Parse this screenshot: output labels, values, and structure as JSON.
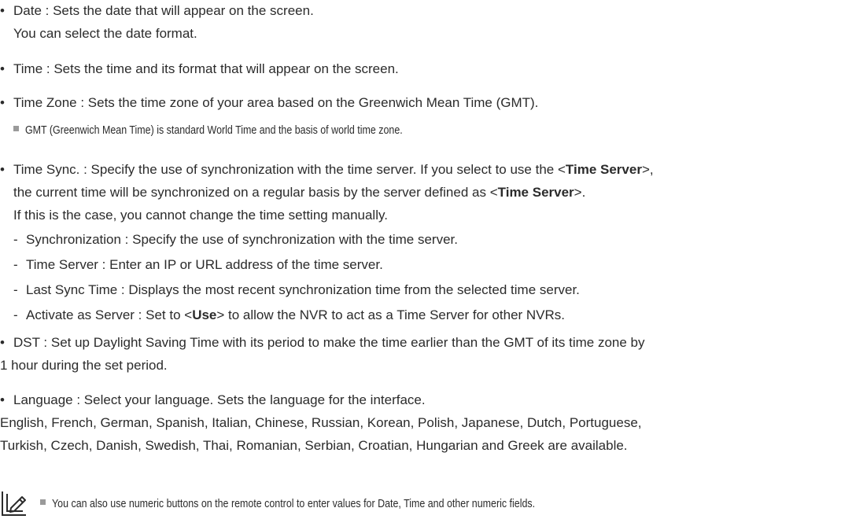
{
  "items": {
    "date": {
      "line1": "Date : Sets the date that will appear on the screen.",
      "line2": "You can select the date format."
    },
    "time": {
      "line1": "Time : Sets the time and its format that will appear on the screen."
    },
    "time_zone": {
      "line1": "Time Zone : Sets the time zone of your area based on the Greenwich Mean Time (GMT).",
      "note": "GMT (Greenwich Mean Time) is standard World Time and the basis of world time zone."
    },
    "time_sync": {
      "line1_a": "Time Sync. : Specify the use of synchronization with the time server. If you select to use the <",
      "line1_bold": "Time Server",
      "line1_b": ">,",
      "line2_a": "the current time will be synchronized on a regular basis by the server defined as <",
      "line2_bold": "Time Server",
      "line2_b": ">.",
      "line3": "If this is the case, you cannot change the time setting manually.",
      "subitems": [
        "Synchronization : Specify the use of synchronization with the time server.",
        "Time Server : Enter an IP or URL address of the time server.",
        "Last Sync Time : Displays the most recent synchronization time from the selected time server."
      ],
      "activate_a": "Activate as Server : Set to <",
      "activate_bold": "Use",
      "activate_b": "> to allow the NVR to act as a Time Server for other NVRs."
    },
    "dst": {
      "line1": "DST : Set up Daylight Saving Time with its period to make the time earlier than the GMT of its time zone by",
      "line2": "1 hour during the set period."
    },
    "language": {
      "line1": "Language : Select your language. Sets the language for the interface.",
      "line2": "English, French, German, Spanish, Italian, Chinese, Russian, Korean, Polish, Japanese, Dutch, Portuguese,",
      "line3": "Turkish, Czech, Danish, Swedish, Thai, Romanian, Serbian, Croatian, Hungarian and Greek are available."
    }
  },
  "footer_note": "You can also use numeric buttons on the remote control to enter values for Date, Time and other numeric fields.",
  "icons": {
    "bullet": "•",
    "dash": "-",
    "note_marker": "gray-square",
    "pencil": "pencil-note-icon"
  }
}
